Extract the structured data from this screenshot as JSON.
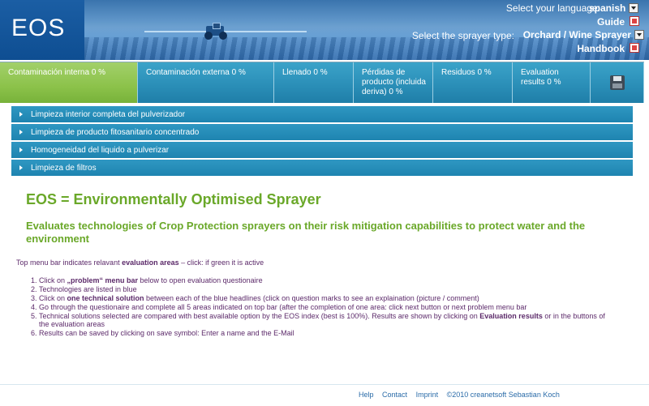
{
  "header": {
    "logo": "EOS",
    "language_label": "Select your language:",
    "language_value": "spanish",
    "guide_label": "Guide",
    "sprayer_label": "Select the sprayer type:",
    "sprayer_value": "Orchard / Wine Sprayer",
    "handbook_label": "Handbook"
  },
  "tabs": [
    {
      "label": "Contaminación interna 0 %",
      "active": true
    },
    {
      "label": "Contaminación externa 0 %",
      "active": false
    },
    {
      "label": "Llenado 0 %",
      "active": false
    },
    {
      "label": "Pérdidas de producto (incluida deriva) 0 %",
      "active": false
    },
    {
      "label": "Residuos 0 %",
      "active": false
    },
    {
      "label": "Evaluation results 0 %",
      "active": false
    }
  ],
  "accordion": [
    "Limpieza interior completa del pulverizador",
    "Limpieza de producto fitosanitario concentrado",
    "Homogeneidad del liquido a pulverizar",
    "Limpieza de filtros"
  ],
  "content": {
    "title": "EOS = Environmentally Optimised Sprayer",
    "subtitle": "Evaluates technologies of Crop Protection sprayers on their risk mitigation capabilities to protect water and the environment",
    "intro_pre": "Top menu bar indicates relavant ",
    "intro_bold": "evaluation areas",
    "intro_post": " – click: if green it is active",
    "steps": [
      {
        "pre": "Click on ",
        "bold": "„problem“ menu bar",
        "post": " below to open evaluation questionaire"
      },
      {
        "pre": "Technologies are listed in blue",
        "bold": "",
        "post": ""
      },
      {
        "pre": "Click on ",
        "bold": "one technical solution",
        "post": " between each of the blue headlines (click on question marks to see an explaination (picture / comment)"
      },
      {
        "pre": "Go through the questionaire and complete all 5 areas indicated on top bar (after the completion of one area: click next button or next problem menu bar",
        "bold": "",
        "post": ""
      },
      {
        "pre": "Technical solutions selected are compared with best available option by the EOS index (best is 100%). Results are shown by clicking on ",
        "bold": "Evaluation results",
        "post": " or in the buttons of the evaluation areas"
      },
      {
        "pre": "Results can be saved by clicking on save symbol: Enter a name and the E-Mail",
        "bold": "",
        "post": ""
      }
    ]
  },
  "footer": {
    "help": "Help",
    "contact": "Contact",
    "imprint": "Imprint",
    "copyright": "©2010 creanetsoft Sebastian Koch"
  }
}
